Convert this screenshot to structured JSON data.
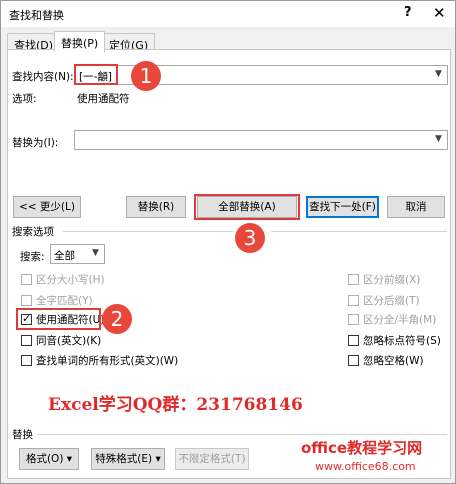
{
  "window": {
    "title": "查找和替换",
    "help": "?",
    "close": "✕"
  },
  "tabs": [
    {
      "label": "查找(D)"
    },
    {
      "label": "替换(P)"
    },
    {
      "label": "定位(G)"
    }
  ],
  "find": {
    "label": "查找内容(N):",
    "value": "[一-龥]",
    "options_label": "选项:",
    "options_value": "使用通配符"
  },
  "replace": {
    "label": "替换为(I):",
    "value": ""
  },
  "buttons": {
    "less": "<< 更少(L)",
    "replace": "替换(R)",
    "replace_all": "全部替换(A)",
    "find_next": "查找下一处(F)",
    "cancel": "取消"
  },
  "search_options": {
    "header": "搜索选项",
    "search_label": "搜索:",
    "search_value": "全部",
    "left": [
      {
        "label": "区分大小写(H)",
        "checked": false,
        "enabled": false
      },
      {
        "label": "全字匹配(Y)",
        "checked": false,
        "enabled": false
      },
      {
        "label": "使用通配符(U)",
        "checked": true,
        "enabled": true
      },
      {
        "label": "同音(英文)(K)",
        "checked": false,
        "enabled": true
      },
      {
        "label": "查找单词的所有形式(英文)(W)",
        "checked": false,
        "enabled": true
      }
    ],
    "right": [
      {
        "label": "区分前缀(X)",
        "checked": false,
        "enabled": false
      },
      {
        "label": "区分后缀(T)",
        "checked": false,
        "enabled": false
      },
      {
        "label": "区分全/半角(M)",
        "checked": false,
        "enabled": false
      },
      {
        "label": "忽略标点符号(S)",
        "checked": false,
        "enabled": true
      },
      {
        "label": "忽略空格(W)",
        "checked": false,
        "enabled": true
      }
    ]
  },
  "replace_section": {
    "header": "替换",
    "format": "格式(O) ▾",
    "special": "特殊格式(E) ▾",
    "no_format": "不限定格式(T)"
  },
  "annotations": {
    "badge1": "1",
    "badge2": "2",
    "badge3": "3",
    "promo": "Excel学习QQ群：231768146",
    "brand": "office教程学习网",
    "site": "www.office68.com"
  },
  "colors": {
    "annotation_red": "#e8473a",
    "focus_blue": "#0078d7"
  }
}
